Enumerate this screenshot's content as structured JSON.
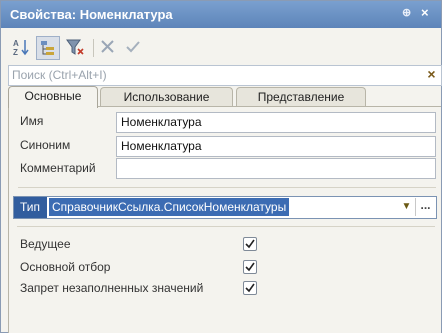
{
  "window": {
    "title": "Свойства: Номенклатура",
    "pin_glyph": "⊕",
    "close_glyph": "×"
  },
  "toolbar": {
    "buttons": [
      {
        "name": "sort-az-icon"
      },
      {
        "name": "categories-icon"
      },
      {
        "name": "filter-icon"
      },
      {
        "name": "delete-icon"
      },
      {
        "name": "apply-icon"
      }
    ]
  },
  "search": {
    "placeholder": "Поиск (Ctrl+Alt+I)",
    "clear_glyph": "×"
  },
  "tabs": [
    {
      "label": "Основные",
      "active": true
    },
    {
      "label": "Использование",
      "active": false
    },
    {
      "label": "Представление",
      "active": false
    }
  ],
  "fields": {
    "name_label": "Имя",
    "name_value": "Номенклатура",
    "synonym_label": "Синоним",
    "synonym_value": "Номенклатура",
    "comment_label": "Комментарий",
    "comment_value": ""
  },
  "type_field": {
    "label": "Тип",
    "value": "СправочникСсылка.СписокНоменклатуры",
    "dropdown_glyph": "▼",
    "more_glyph": "..."
  },
  "checkboxes": [
    {
      "label": "Ведущее",
      "checked": true
    },
    {
      "label": "Основной отбор",
      "checked": true
    },
    {
      "label": "Запрет незаполненных значений",
      "checked": true
    }
  ],
  "colors": {
    "title_bar": "#6a8fc3",
    "selection": "#3c6cb3"
  }
}
